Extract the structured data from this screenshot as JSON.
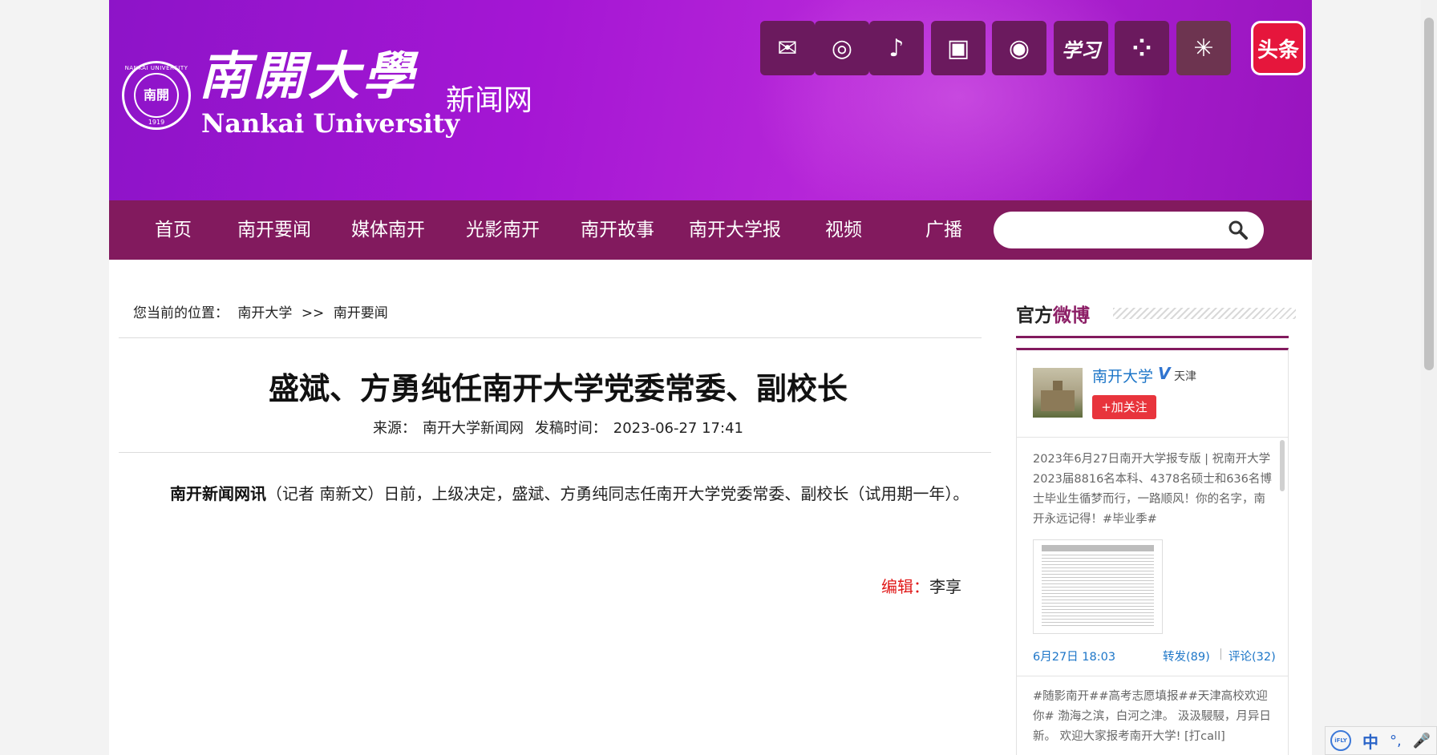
{
  "header": {
    "logo_cn": "南開大學",
    "logo_en": "Nankai University",
    "logo_sub": "新闻网",
    "seal_text": "NANKAI UNIVERSITY",
    "seal_center": "南開",
    "seal_year": "1919",
    "social_icons": [
      {
        "name": "wechat-icon",
        "glyph": "✉"
      },
      {
        "name": "weibo-icon",
        "glyph": "◎"
      },
      {
        "name": "douyin-icon",
        "glyph": "♪"
      },
      {
        "name": "bilibili-icon",
        "glyph": "▣"
      },
      {
        "name": "kuaishou-icon",
        "glyph": "◉"
      },
      {
        "name": "xuexi-icon",
        "glyph": "学习"
      },
      {
        "name": "dots-app-icon",
        "glyph": "⁘"
      },
      {
        "name": "dandelion-icon",
        "glyph": "✳"
      },
      {
        "name": "toutiao-icon",
        "glyph": "头条"
      }
    ]
  },
  "nav": {
    "items": [
      "首页",
      "南开要闻",
      "媒体南开",
      "光影南开",
      "南开故事",
      "南开大学报",
      "视频",
      "广播"
    ],
    "search_placeholder": ""
  },
  "breadcrumb": {
    "prefix": "您当前的位置：",
    "home": "南开大学",
    "sep": ">>",
    "current": "南开要闻"
  },
  "article": {
    "title": "盛斌、方勇纯任南开大学党委常委、副校长",
    "source_label": "来源：",
    "source": "南开大学新闻网",
    "date_label": "发稿时间：",
    "date": "2023-06-27 17:41",
    "lead": "南开新闻网讯",
    "body": "（记者 南新文）日前，上级决定，盛斌、方勇纯同志任南开大学党委常委、副校长（试用期一年）。",
    "editor_label": "编辑：",
    "editor": "李享"
  },
  "sidebar": {
    "title_plain": "官方",
    "title_accent": "微博",
    "account_name": "南开大学",
    "verified": "V",
    "location": "天津",
    "follow_label": "+加关注",
    "posts": [
      {
        "text": "2023年6月27日南开大学报专版 | 祝南开大学2023届8816名本科、4378名硕士和636名博士毕业生循梦而行，一路顺风！你的名字，南开永远记得！#毕业季#",
        "time": "6月27日 18:03",
        "repost": "转发(89)",
        "bar": "|",
        "comment": "评论(32)"
      },
      {
        "text": "#随影南开##高考志愿填报##天津高校欢迎你# 渤海之滨，白河之津。 汲汲駸駸，月异日新。 欢迎大家报考南开大学! [打call]"
      }
    ]
  },
  "ime": {
    "logo": "iFLY",
    "mode": "中",
    "punct": "°,",
    "mic": "🎤"
  },
  "colors": {
    "header_purple": "#a516d4",
    "nav_bg": "#821a5e",
    "link_blue": "#1d76c8",
    "editor_red": "#e01818",
    "follow_red": "#e8343c"
  }
}
